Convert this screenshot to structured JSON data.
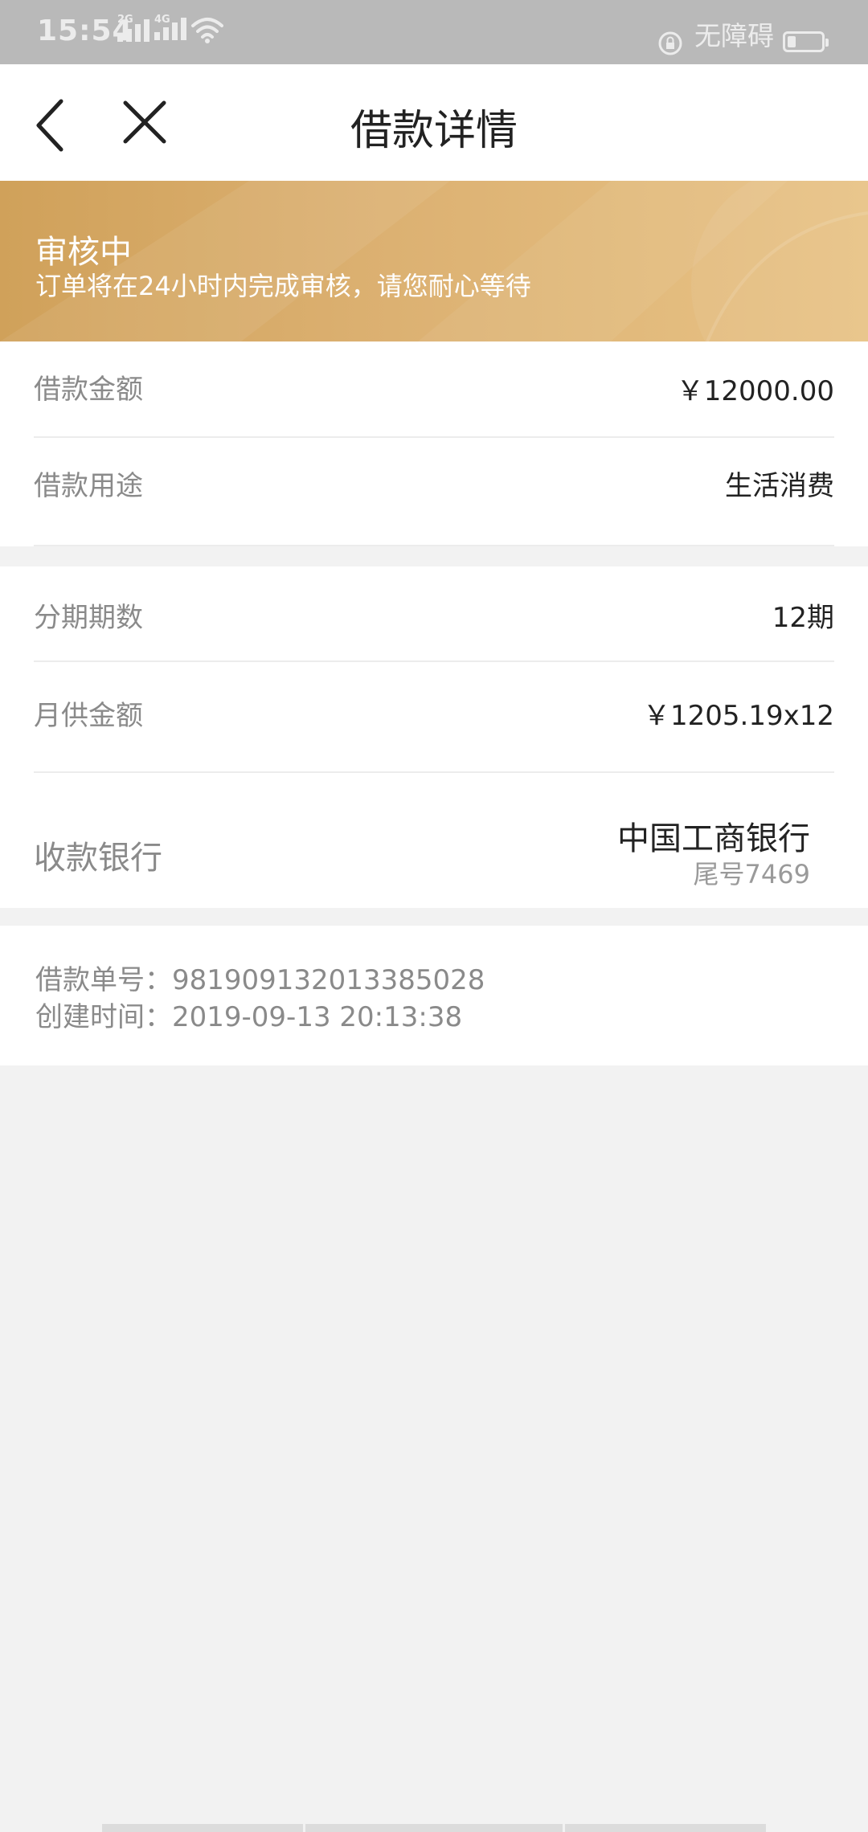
{
  "status_bar": {
    "time": "15:54",
    "net1": "2G",
    "net2": "4G",
    "accessibility_label": "无障碍"
  },
  "nav": {
    "title": "借款详情"
  },
  "banner": {
    "status": "审核中",
    "message": "订单将在24小时内完成审核，请您耐心等待"
  },
  "loan": {
    "amount_label": "借款金额",
    "amount_value": "￥12000.00",
    "purpose_label": "借款用途",
    "purpose_value": "生活消费",
    "periods_label": "分期期数",
    "periods_value": "12期",
    "monthly_label": "月供金额",
    "monthly_value": "￥1205.19x12",
    "bank_label": "收款银行",
    "bank_name": "中国工商银行",
    "bank_tail": "尾号7469"
  },
  "order": {
    "number_line": "借款单号：981909132013385028",
    "created_line": "创建时间：2019-09-13 20:13:38"
  },
  "colors": {
    "banner_start": "#d0a15a",
    "banner_end": "#e8c386",
    "background": "#f2f2f2"
  }
}
